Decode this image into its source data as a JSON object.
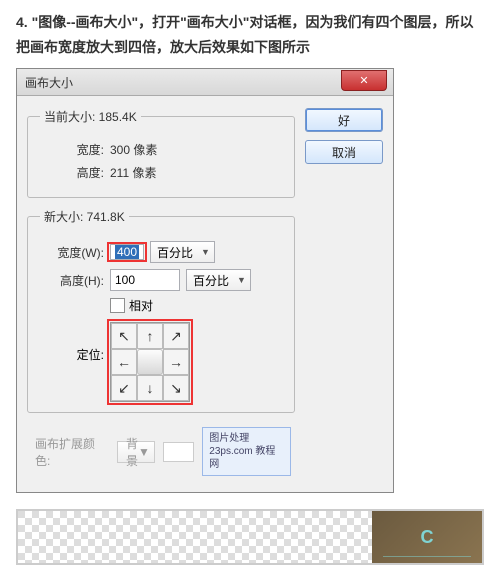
{
  "instruction": "4.  \"图像--画布大小\"，打开\"画布大小\"对话框，因为我们有四个图层，所以把画布宽度放大到四倍，放大后效果如下图所示",
  "dialog": {
    "title": "画布大小",
    "current": {
      "legend": "当前大小: 185.4K",
      "width_label": "宽度:",
      "width_value": "300 像素",
      "height_label": "高度:",
      "height_value": "211 像素"
    },
    "new": {
      "legend": "新大小: 741.8K",
      "width_label": "宽度(W):",
      "width_value": "400",
      "width_unit": "百分比",
      "height_label": "高度(H):",
      "height_value": "100",
      "height_unit": "百分比",
      "relative_label": "相对",
      "anchor_label": "定位:"
    },
    "extension": {
      "label": "画布扩展颜色:",
      "value": "背景"
    },
    "buttons": {
      "ok": "好",
      "cancel": "取消"
    },
    "watermark": {
      "line1": "图片处理",
      "line2": "23ps.com 教程网"
    }
  },
  "thumb_text": "C"
}
